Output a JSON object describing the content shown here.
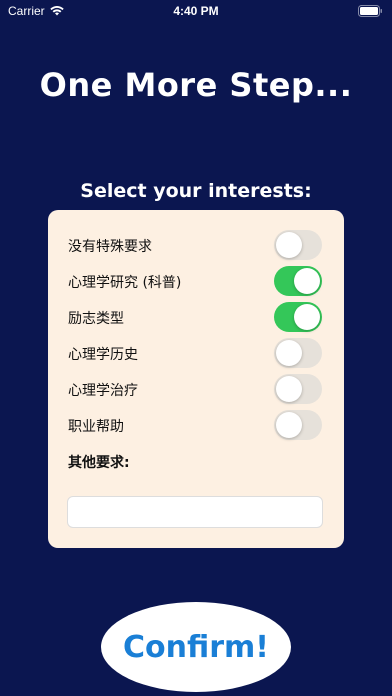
{
  "status_bar": {
    "carrier": "Carrier",
    "time": "4:40 PM"
  },
  "title": "One More Step...",
  "subtitle": "Select your interests:",
  "interests": [
    {
      "label": "没有特殊要求",
      "on": false
    },
    {
      "label": "心理学研究 (科普)",
      "on": true
    },
    {
      "label": "励志类型",
      "on": true
    },
    {
      "label": "心理学历史",
      "on": false
    },
    {
      "label": "心理学治疗",
      "on": false
    },
    {
      "label": "职业帮助",
      "on": false
    }
  ],
  "other": {
    "label": "其他要求:",
    "value": "",
    "placeholder": ""
  },
  "confirm_label": "Confirm!",
  "colors": {
    "background": "#0b1650",
    "panel": "#fdf0e2",
    "switch_on": "#34c759",
    "switch_off": "#e6e1da",
    "confirm_text": "#1a7fd6"
  }
}
